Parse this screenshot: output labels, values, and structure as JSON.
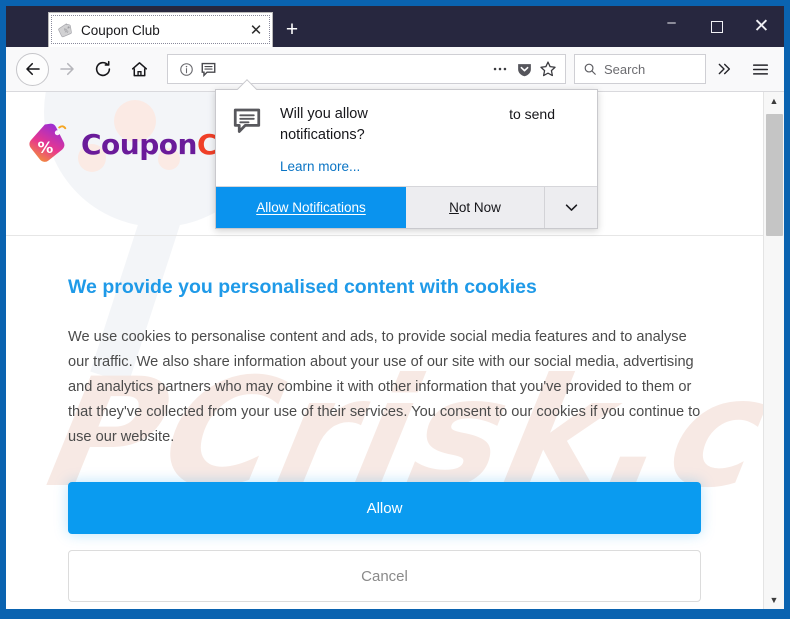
{
  "window": {
    "controls": {
      "minimize": "minimize-icon",
      "maximize": "maximize-icon",
      "close": "close-icon"
    }
  },
  "tabbar": {
    "tabs": [
      {
        "title": "Coupon Club",
        "favicon": "coupon-tag-favicon",
        "close_label": "✕",
        "active": true
      }
    ],
    "new_tab_label": "+"
  },
  "toolbar": {
    "back_icon": "back-arrow-icon",
    "forward_icon": "forward-arrow-icon",
    "reload_icon": "reload-icon",
    "home_icon": "home-icon",
    "url_value": "",
    "url_placeholder": "",
    "identity_icon": "info-circle-icon",
    "notification_permission_icon": "speech-bubble-icon",
    "page_actions_icon": "ellipsis-icon",
    "pocket_icon": "pocket-shield-icon",
    "bookmark_icon": "star-icon",
    "search_placeholder": "Search",
    "search_icon": "magnifier-icon",
    "overflow_icon": "double-chevron-right-icon",
    "menu_icon": "hamburger-menu-icon"
  },
  "notification_popup": {
    "icon": "speech-bubble-icon",
    "question": "Will you allow notifications?",
    "origin_text": "to send",
    "learn_more": "Learn more...",
    "allow_label": "Allow Notifications",
    "allow_accesskey": "A",
    "not_now_label": "Not Now",
    "not_now_accesskey": "N",
    "dropdown_icon": "chevron-down-icon",
    "allow_color": "#0a93ee"
  },
  "page": {
    "brand": {
      "logo_icon": "coupon-percent-tag-logo",
      "name_part_1": "Coupon",
      "name_part_2": "Club",
      "color_1": "#6a1b9a",
      "color_2": "#f04028"
    },
    "watermark_text": "PCrisk.com",
    "cookie_consent": {
      "title": "We provide you personalised content with cookies",
      "title_color": "#1f9ae8",
      "body": "We use cookies to personalise content and ads, to provide social media features and to analyse our traffic. We also share information about your use of our site with our social media, advertising and analytics partners who may combine it with other information that you've provided to them or that they've collected from your use of their services. You consent to our cookies if you continue to use our website.",
      "allow_label": "Allow",
      "allow_color": "#0a9bf0",
      "cancel_label": "Cancel"
    }
  },
  "scrollbar": {
    "up_arrow": "▲",
    "down_arrow": "▼"
  }
}
